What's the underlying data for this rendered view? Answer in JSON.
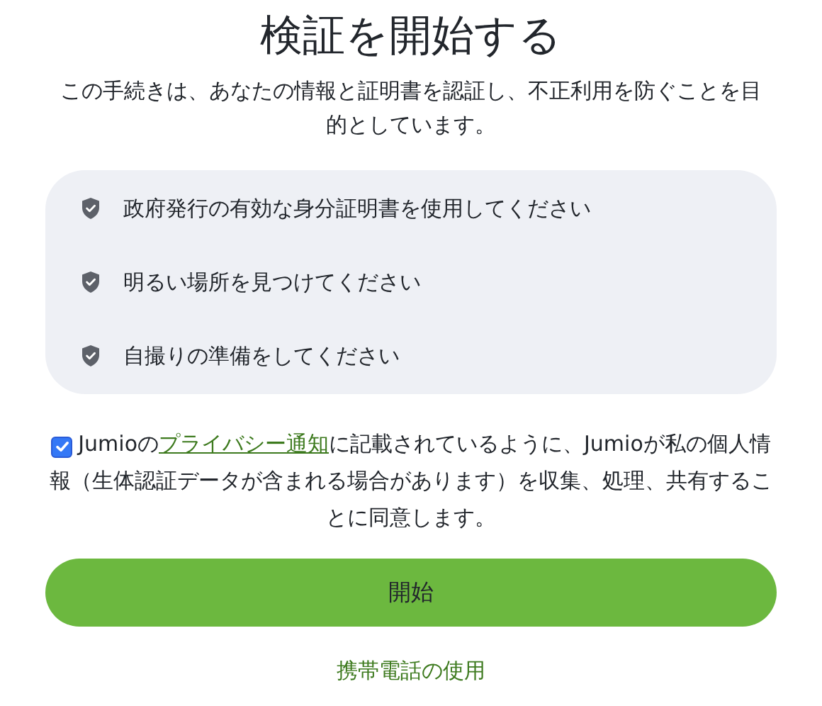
{
  "title": "検証を開始する",
  "description": "この手続きは、あなたの情報と証明書を認証し、不正利用を防ぐことを目的としています。",
  "requirements": [
    {
      "label": "政府発行の有効な身分証明書を使用してください"
    },
    {
      "label": "明るい場所を見つけてください"
    },
    {
      "label": "自撮りの準備をしてください"
    }
  ],
  "consent": {
    "checked": true,
    "before": "Jumioの",
    "link": "プライバシー通知",
    "after": "に記載されているように、Jumioが私の個人情報（生体認証データが含まれる場合があります）を収集、処理、共有することに同意します。"
  },
  "start_button": "開始",
  "phone_link": "携帯電話の使用"
}
